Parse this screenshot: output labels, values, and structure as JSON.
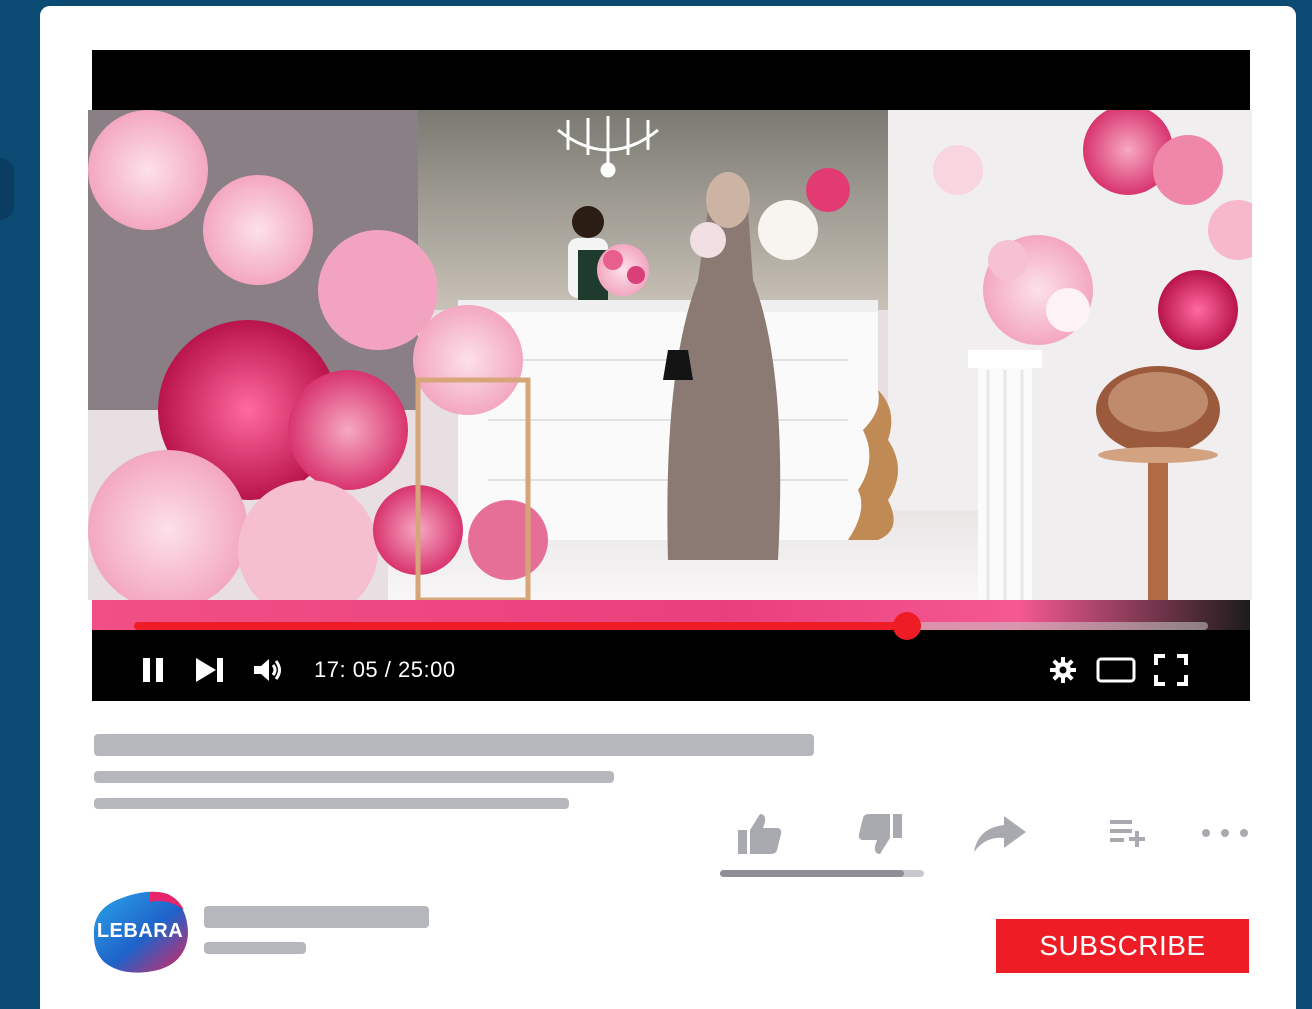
{
  "player": {
    "time_display": "17: 05 / 25:00",
    "progress_fraction": 0.72,
    "accent_color": "#ee1c25",
    "controls": {
      "play_state": "pause-icon",
      "next": "skip-next-icon",
      "volume": "volume-icon",
      "settings": "gear-icon",
      "theater": "theater-mode-icon",
      "fullscreen": "fullscreen-icon"
    }
  },
  "actions": {
    "like": "thumbs-up-icon",
    "dislike": "thumbs-down-icon",
    "share": "share-icon",
    "save": "add-to-playlist-icon",
    "more": "more-icon",
    "like_ratio": 0.9
  },
  "channel": {
    "avatar_text": "LEBARA",
    "subscribe_label": "SUBSCRIBE",
    "subscribe_color": "#ee1c25"
  }
}
